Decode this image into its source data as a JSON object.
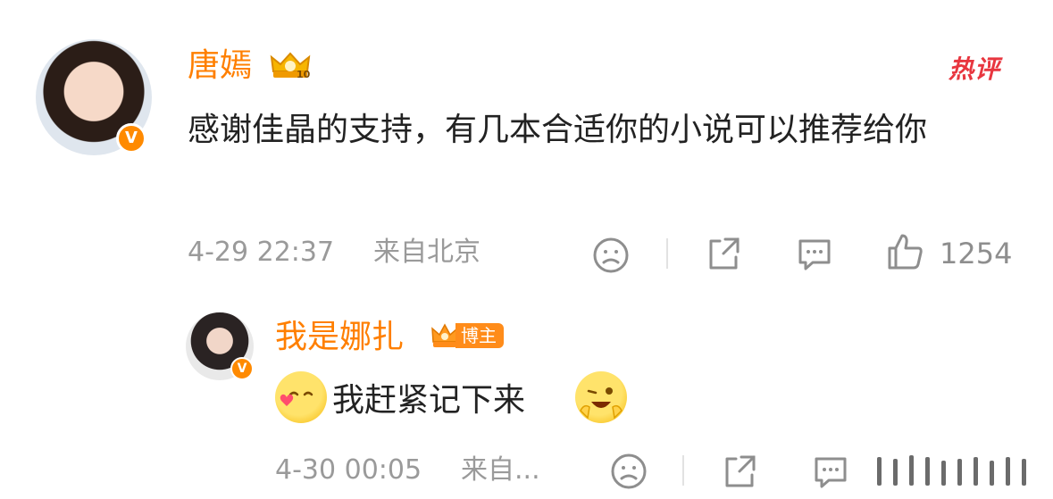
{
  "hot_label": "热评",
  "comment": {
    "author": "唐嫣",
    "badge_icon": "crown-level-10",
    "text": "感谢佳晶的支持，有几本合适你的小说可以推荐给你",
    "time": "4-29 22:37",
    "location": "来自北京",
    "likes": "1254",
    "verified_mark": "V"
  },
  "reply": {
    "author": "我是娜扎",
    "badge_label": "博主",
    "text": "我赶紧记下来",
    "time": "4-30 00:05",
    "location": "来自...",
    "verified_mark": "V"
  },
  "colors": {
    "name": "#ff7f00",
    "hot": "#e8363f",
    "meta": "#9a9a9a",
    "text": "#222222"
  }
}
